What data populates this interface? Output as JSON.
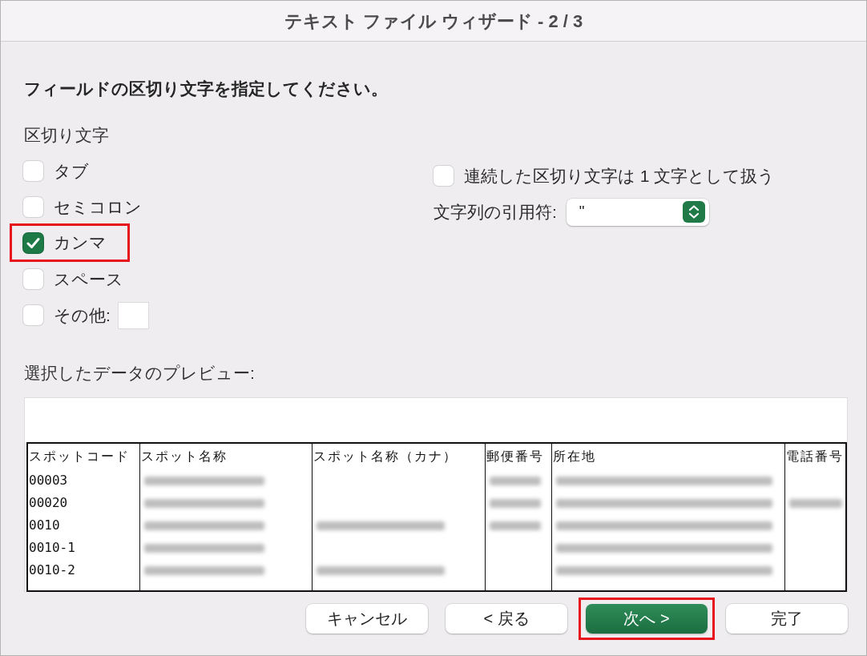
{
  "window": {
    "title": "テキスト ファイル ウィザード - 2 / 3"
  },
  "instruction": "フィールドの区切り文字を指定してください。",
  "delimiters": {
    "label": "区切り文字",
    "options": [
      {
        "label": "タブ",
        "kind": "plain",
        "checked": false,
        "highlighted": false
      },
      {
        "label": "セミコロン",
        "kind": "plain",
        "checked": false,
        "highlighted": false
      },
      {
        "label": "カンマ",
        "kind": "plain",
        "checked": true,
        "highlighted": true
      },
      {
        "label": "スペース",
        "kind": "plain",
        "checked": false,
        "highlighted": false
      },
      {
        "label": "その他:",
        "kind": "other",
        "checked": false,
        "highlighted": false
      }
    ]
  },
  "consecutive": {
    "label": "連続した区切り文字は 1 文字として扱う",
    "checked": false
  },
  "text_qualifier": {
    "label": "文字列の引用符:",
    "value": "\""
  },
  "preview": {
    "label": "選択したデータのプレビュー:",
    "columns": [
      "スポットコード",
      "スポット名称",
      "スポット名称（カナ）",
      "郵便番号",
      "所在地",
      "電話番号"
    ],
    "rows": [
      {
        "code": "00003",
        "masked": [
          true,
          false,
          true,
          true,
          false
        ]
      },
      {
        "code": "00020",
        "masked": [
          true,
          false,
          true,
          true,
          true
        ]
      },
      {
        "code": "0010",
        "masked": [
          true,
          true,
          true,
          true,
          false
        ]
      },
      {
        "code": "0010-1",
        "masked": [
          true,
          false,
          false,
          true,
          false
        ]
      },
      {
        "code": "0010-2",
        "masked": [
          true,
          true,
          false,
          true,
          false
        ]
      }
    ]
  },
  "buttons": [
    {
      "label": "キャンセル",
      "kind": "default",
      "highlighted": false
    },
    {
      "label": "< 戻る",
      "kind": "default",
      "highlighted": false
    },
    {
      "label": "次へ >",
      "kind": "primary",
      "highlighted": true
    },
    {
      "label": "完了",
      "kind": "default",
      "highlighted": false
    }
  ]
}
